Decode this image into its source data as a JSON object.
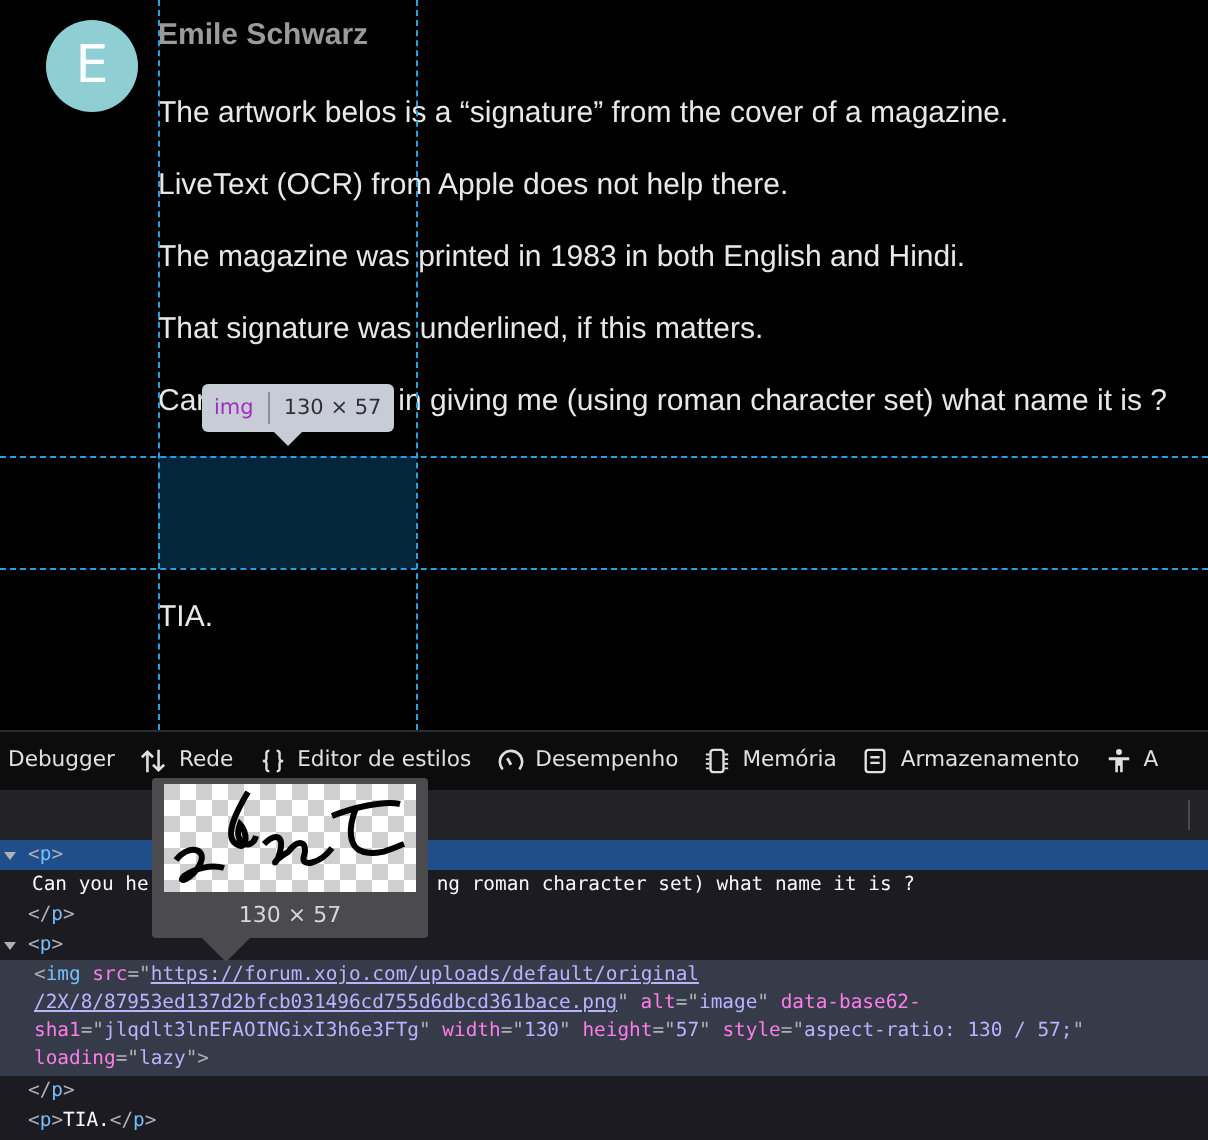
{
  "post": {
    "avatar_letter": "E",
    "author": "Emile Schwarz",
    "paragraphs": [
      "The artwork belos is a “signature” from the cover of a magazine.",
      "LiveText (OCR) from Apple does not help there.",
      "The magazine was printed in 1983 in both English and Hindi.",
      "That signature was underlined, if this matters."
    ],
    "partial_line": {
      "before": "Car",
      "after": "in giving me (using roman character set) what name it is ?"
    },
    "closing": "TIA."
  },
  "highlight_tooltip": {
    "tag": "img",
    "size": "130 × 57"
  },
  "toolbar": {
    "tabs": [
      {
        "label": "Debugger",
        "kind": "plain"
      },
      {
        "label": "Rede",
        "kind": "network"
      },
      {
        "label": "Editor de estilos",
        "kind": "braces"
      },
      {
        "label": "Desempenho",
        "kind": "gauge"
      },
      {
        "label": "Memória",
        "kind": "chip"
      },
      {
        "label": "Armazenamento",
        "kind": "storage"
      },
      {
        "label": "A",
        "kind": "person"
      }
    ]
  },
  "image_preview": {
    "size": "130 × 57"
  },
  "markup": [
    {
      "kind": "element",
      "expanded": true,
      "selected": true,
      "open": [
        {
          "kind": "punctuation",
          "s": "<"
        },
        {
          "kind": "tag",
          "s": "p"
        },
        {
          "kind": "punctuation",
          "s": ">"
        }
      ],
      "children": [
        {
          "kind": "text",
          "before": "Can you he",
          "after": "ng roman character set) what name it is ?"
        }
      ],
      "close": [
        {
          "kind": "punctuation",
          "s": "</"
        },
        {
          "kind": "tag",
          "s": "p"
        },
        {
          "kind": "punctuation",
          "s": ">"
        }
      ]
    },
    {
      "kind": "element",
      "expanded": true,
      "selected": false,
      "open": [
        {
          "kind": "punctuation",
          "s": "<"
        },
        {
          "kind": "tag",
          "s": "p"
        },
        {
          "kind": "punctuation",
          "s": ">"
        }
      ],
      "children": [
        {
          "kind": "block",
          "lines": [
            [
              {
                "kind": "punctuation",
                "s": "<"
              },
              {
                "kind": "tag",
                "s": "img"
              },
              {
                "kind": "attribute",
                "s": " src"
              },
              {
                "kind": "punctuation",
                "s": "=\""
              },
              {
                "kind": "link",
                "s": "https://forum.xojo.com/uploads/default/original"
              }
            ],
            [
              {
                "kind": "link",
                "s": "/2X/8/87953ed137d2bfcb031496cd755d6dbcd361bace.png"
              },
              {
                "kind": "punctuation",
                "s": "\""
              },
              {
                "kind": "attribute",
                "s": " alt"
              },
              {
                "kind": "punctuation",
                "s": "=\""
              },
              {
                "kind": "value",
                "s": "image"
              },
              {
                "kind": "punctuation",
                "s": "\""
              },
              {
                "kind": "attribute",
                "s": " data-base62-"
              }
            ],
            [
              {
                "kind": "attribute",
                "s": "sha1"
              },
              {
                "kind": "punctuation",
                "s": "=\""
              },
              {
                "kind": "value",
                "s": "jlqdlt3lnEFAOINGixI3h6e3FTg"
              },
              {
                "kind": "punctuation",
                "s": "\""
              },
              {
                "kind": "attribute",
                "s": " width"
              },
              {
                "kind": "punctuation",
                "s": "=\""
              },
              {
                "kind": "value",
                "s": "130"
              },
              {
                "kind": "punctuation",
                "s": "\""
              },
              {
                "kind": "attribute",
                "s": " height"
              },
              {
                "kind": "punctuation",
                "s": "=\""
              },
              {
                "kind": "value",
                "s": "57"
              },
              {
                "kind": "punctuation",
                "s": "\""
              },
              {
                "kind": "attribute",
                "s": " style"
              },
              {
                "kind": "punctuation",
                "s": "=\""
              },
              {
                "kind": "value",
                "s": "aspect-ratio: 130 / 57;"
              },
              {
                "kind": "punctuation",
                "s": "\""
              }
            ],
            [
              {
                "kind": "attribute",
                "s": "loading"
              },
              {
                "kind": "punctuation",
                "s": "=\""
              },
              {
                "kind": "value",
                "s": "lazy"
              },
              {
                "kind": "punctuation",
                "s": "\">"
              }
            ]
          ]
        }
      ],
      "close": [
        {
          "kind": "punctuation",
          "s": "</"
        },
        {
          "kind": "tag",
          "s": "p"
        },
        {
          "kind": "punctuation",
          "s": ">"
        }
      ]
    },
    {
      "kind": "inline",
      "tokens": [
        {
          "kind": "punctuation",
          "s": "<"
        },
        {
          "kind": "tag",
          "s": "p"
        },
        {
          "kind": "punctuation",
          "s": ">"
        },
        {
          "kind": "text",
          "s": "TIA."
        },
        {
          "kind": "punctuation",
          "s": "</"
        },
        {
          "kind": "tag",
          "s": "p"
        },
        {
          "kind": "punctuation",
          "s": ">"
        }
      ]
    }
  ]
}
